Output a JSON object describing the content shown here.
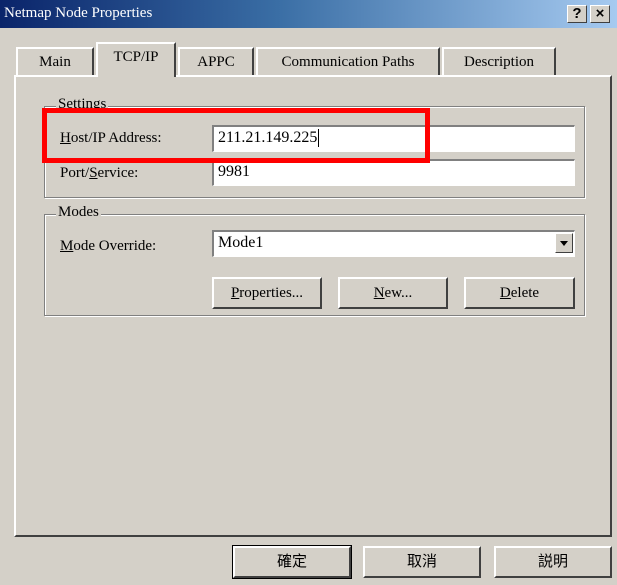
{
  "window": {
    "title": "Netmap Node Properties",
    "help_label": "?",
    "close_label": "×"
  },
  "tabs": [
    {
      "label": "Main"
    },
    {
      "label": "TCP/IP",
      "selected": true
    },
    {
      "label": "APPC"
    },
    {
      "label": "Communication Paths"
    },
    {
      "label": "Description"
    }
  ],
  "settings": {
    "group_label": "Settings",
    "host_label_accel": "H",
    "host_label_rest": "ost/IP Address:",
    "host_value": "211.21.149.225",
    "port_label_pre": "Port/",
    "port_label_accel": "S",
    "port_label_post": "ervice:",
    "port_value": "9981"
  },
  "modes": {
    "group_label": "Modes",
    "override_label_accel": "M",
    "override_label_rest": "ode Override:",
    "selected_value": "Mode1",
    "properties_accel": "P",
    "properties_rest": "roperties...",
    "new_accel": "N",
    "new_rest": "ew...",
    "delete_accel": "D",
    "delete_rest": "elete"
  },
  "footer": {
    "ok_label": "確定",
    "cancel_label": "取消",
    "help_label": "説明"
  },
  "colors": {
    "annotation_box": "#ff0000",
    "titlebar_start": "#0a246a",
    "face": "#d4d0c8"
  }
}
